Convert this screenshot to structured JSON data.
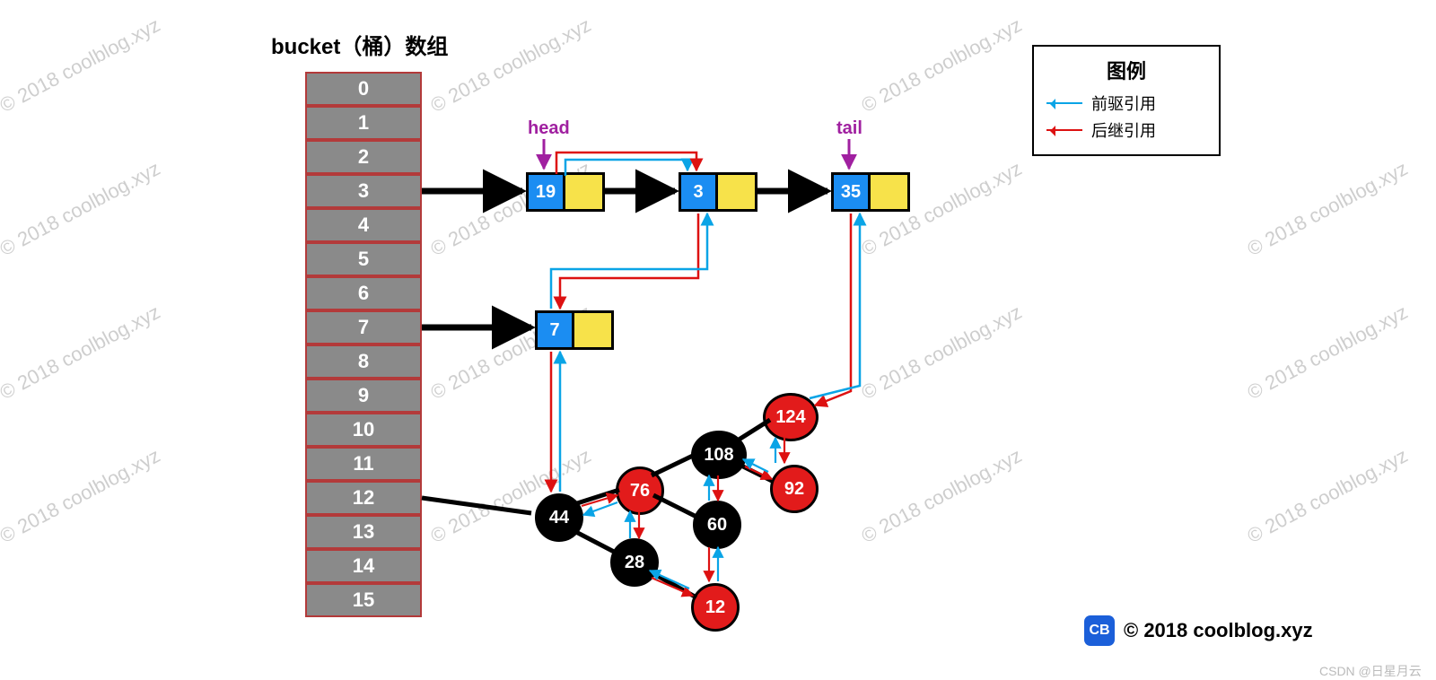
{
  "watermark_text": "© 2018 coolblog.xyz",
  "title": "bucket（桶）数组",
  "buckets": [
    "0",
    "1",
    "2",
    "3",
    "4",
    "5",
    "6",
    "7",
    "8",
    "9",
    "10",
    "11",
    "12",
    "13",
    "14",
    "15"
  ],
  "labels": {
    "head": "head",
    "tail": "tail"
  },
  "linked_list": {
    "bucket3": [
      {
        "id": "n19",
        "value": "19"
      },
      {
        "id": "n3",
        "value": "3"
      },
      {
        "id": "n35",
        "value": "35"
      }
    ],
    "bucket7": [
      {
        "id": "n7",
        "value": "7"
      }
    ]
  },
  "tree": {
    "bucket": 12,
    "nodes": [
      {
        "id": "t44",
        "value": "44",
        "color": "black"
      },
      {
        "id": "t76",
        "value": "76",
        "color": "red"
      },
      {
        "id": "t28",
        "value": "28",
        "color": "black"
      },
      {
        "id": "t60",
        "value": "60",
        "color": "black"
      },
      {
        "id": "t12",
        "value": "12",
        "color": "red"
      },
      {
        "id": "t108",
        "value": "108",
        "color": "black"
      },
      {
        "id": "t124",
        "value": "124",
        "color": "red"
      },
      {
        "id": "t92",
        "value": "92",
        "color": "red"
      }
    ],
    "edges": [
      [
        "t44",
        "t76"
      ],
      [
        "t44",
        "t28"
      ],
      [
        "t76",
        "t60"
      ],
      [
        "t76",
        "t108"
      ],
      [
        "t28",
        "t12"
      ],
      [
        "t108",
        "t124"
      ],
      [
        "t108",
        "t92"
      ]
    ]
  },
  "legend": {
    "title": "图例",
    "prev": "前驱引用",
    "next": "后继引用"
  },
  "credit": {
    "badge": "CB",
    "text": "© 2018 coolblog.xyz"
  },
  "csdn": "CSDN @日星月云",
  "chart_data": {
    "type": "diagram",
    "description": "LinkedHashMap-style structure: bucket array 0..15; bucket 3 → linked list 19→3→35; bucket 7 → single node 7; bucket 12 → red-black tree rooted at 44 with nodes 44(B),76(R),28(B),60(B),12(R),108(B),124(R),92(R). Blue arrows = before/predecessor links, red arrows = after/successor links, forming a doubly-linked insertion-order list head→19→3→35→7→44→76→28→60→108→124→92 (with 12 inserted after 28) and tail at 35 in the visible list chain above the tree.",
    "head": "19",
    "tail": "35"
  }
}
